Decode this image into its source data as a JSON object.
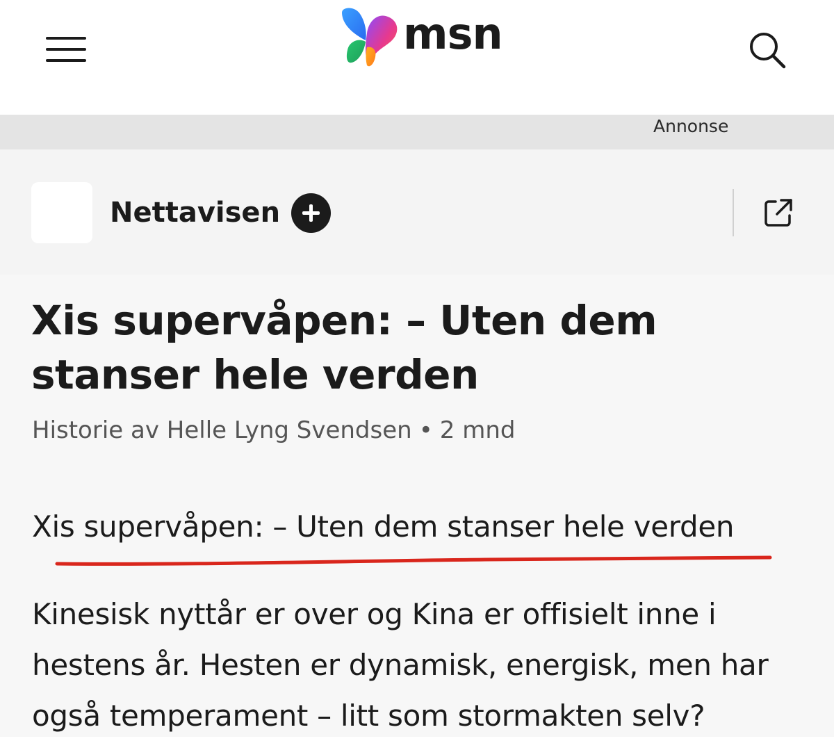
{
  "header": {
    "menu_icon": "hamburger-menu-icon",
    "logo_text": "msn",
    "search_icon": "search-icon"
  },
  "ad": {
    "label": "Annonse"
  },
  "publisher": {
    "name": "Nettavisen",
    "follow_icon": "plus-icon",
    "open_icon": "open-external-icon"
  },
  "article": {
    "headline": "Xis supervåpen: – Uten dem stanser hele verden",
    "byline": "Historie av Helle Lyng Svendsen",
    "byline_separator": "•",
    "age": "2 mnd",
    "subtitle": "Xis supervåpen: – Uten dem stanser hele verden",
    "body": "Kinesisk nyttår er over og Kina er offisielt inne i hestens år. Hesten er dynamisk, energisk, men har også temperament – litt som stormakten selv?"
  },
  "colors": {
    "text": "#1b1b1b",
    "muted": "#555555",
    "annotation_underline": "#d9261c",
    "ad_strip": "#e4e4e4"
  }
}
